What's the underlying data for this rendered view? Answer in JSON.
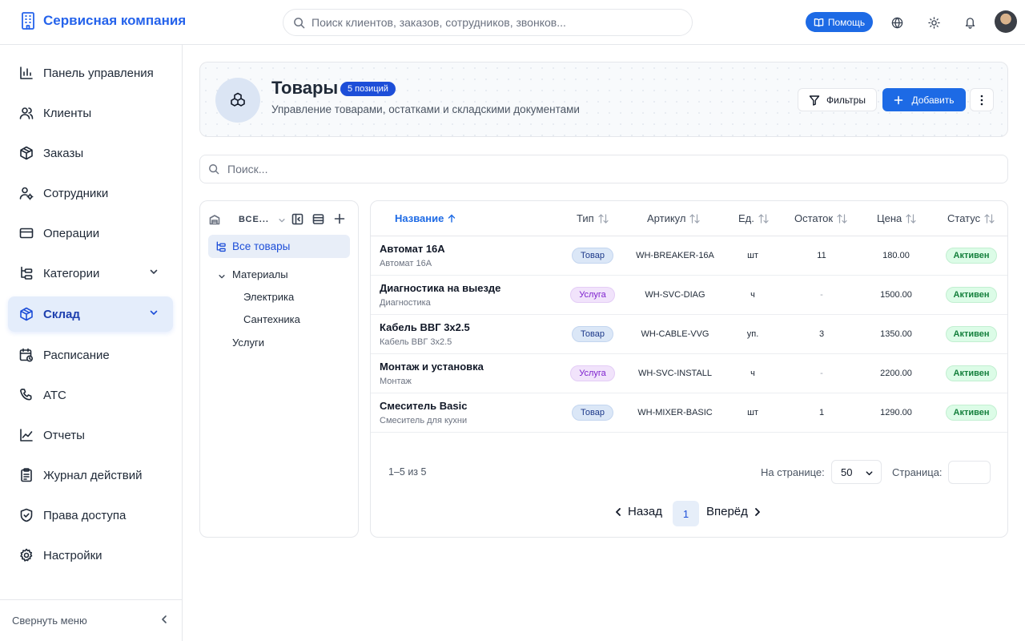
{
  "app": {
    "brand": "Сервисная компания"
  },
  "topbar": {
    "search_placeholder": "Поиск клиентов, заказов, сотрудников, звонков...",
    "help_label": "Помощь"
  },
  "sidebar": {
    "items": [
      {
        "label": "Панель управления",
        "icon": "dashboard-icon"
      },
      {
        "label": "Клиенты",
        "icon": "users-icon"
      },
      {
        "label": "Заказы",
        "icon": "box-icon"
      },
      {
        "label": "Сотрудники",
        "icon": "staff-icon"
      },
      {
        "label": "Операции",
        "icon": "card-icon"
      },
      {
        "label": "Категории",
        "icon": "tree-icon"
      },
      {
        "label": "Склад",
        "icon": "warehouse-icon"
      },
      {
        "label": "Расписание",
        "icon": "calendar-icon"
      },
      {
        "label": "АТС",
        "icon": "phone-icon"
      },
      {
        "label": "Отчеты",
        "icon": "chart-icon"
      },
      {
        "label": "Журнал действий",
        "icon": "clipboard-icon"
      },
      {
        "label": "Права доступа",
        "icon": "shield-icon"
      },
      {
        "label": "Настройки",
        "icon": "gear-icon"
      }
    ],
    "collapse_label": "Свернуть меню"
  },
  "header": {
    "title": "Товары",
    "count_badge": "5 позиций",
    "subtitle": "Управление товарами, остатками и складскими документами",
    "filters_label": "Фильтры",
    "add_label": "Добавить"
  },
  "list_search": {
    "placeholder": "Поиск..."
  },
  "tree": {
    "selector": "ВСЕ...",
    "nodes": {
      "all": "Все товары",
      "materials": "Материалы",
      "electrics": "Электрика",
      "plumbing": "Сантехника",
      "services": "Услуги"
    }
  },
  "table": {
    "columns": [
      "Название",
      "Тип",
      "Артикул",
      "Ед.",
      "Остаток",
      "Цена",
      "Статус"
    ],
    "rows": [
      {
        "name": "Автомат 16А",
        "sub": "Автомат 16А",
        "type": "Товар",
        "type_kind": "goods",
        "sku": "WH-BREAKER-16A",
        "unit": "шт",
        "stock": "11",
        "price": "180.00",
        "status": "Активен"
      },
      {
        "name": "Диагностика на выезде",
        "sub": "Диагностика",
        "type": "Услуга",
        "type_kind": "service",
        "sku": "WH-SVC-DIAG",
        "unit": "ч",
        "stock": "-",
        "price": "1500.00",
        "status": "Активен"
      },
      {
        "name": "Кабель ВВГ 3х2.5",
        "sub": "Кабель ВВГ 3х2.5",
        "type": "Товар",
        "type_kind": "goods",
        "sku": "WH-CABLE-VVG",
        "unit": "уп.",
        "stock": "3",
        "price": "1350.00",
        "status": "Активен"
      },
      {
        "name": "Монтаж и установка",
        "sub": "Монтаж",
        "type": "Услуга",
        "type_kind": "service",
        "sku": "WH-SVC-INSTALL",
        "unit": "ч",
        "stock": "-",
        "price": "2200.00",
        "status": "Активен"
      },
      {
        "name": "Смеситель Basic",
        "sub": "Смеситель для кухни",
        "type": "Товар",
        "type_kind": "goods",
        "sku": "WH-MIXER-BASIC",
        "unit": "шт",
        "stock": "1",
        "price": "1290.00",
        "status": "Активен"
      }
    ]
  },
  "pagination": {
    "range": "1–5 из 5",
    "per_page_label": "На странице:",
    "per_page_value": "50",
    "page_label": "Страница:",
    "prev_label": "Назад",
    "current_page": "1",
    "next_label": "Вперёд"
  },
  "colors": {
    "accent": "#1d6ae5",
    "active_bg": "#e4edfb",
    "status_green": "#15803d",
    "service_purple": "#7e22ce"
  }
}
